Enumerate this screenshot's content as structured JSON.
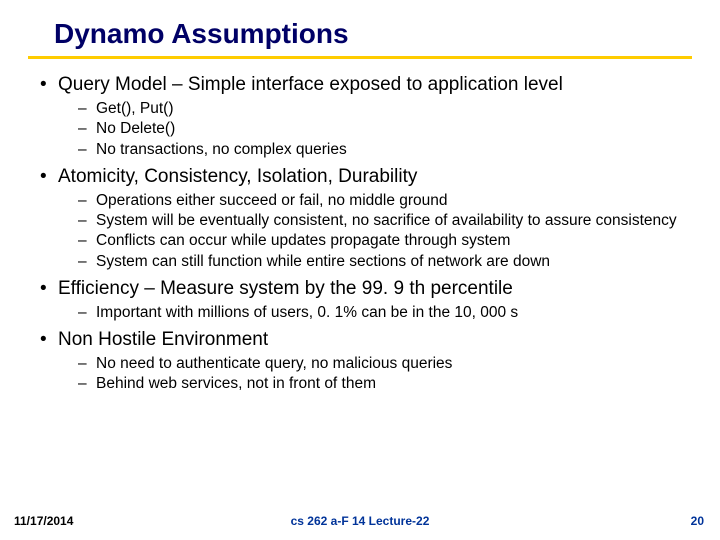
{
  "title": "Dynamo Assumptions",
  "bullets": [
    {
      "text": "Query Model – Simple interface exposed to application level",
      "sub": [
        "Get(), Put()",
        "No Delete()",
        "No transactions, no complex queries"
      ]
    },
    {
      "text": "Atomicity, Consistency, Isolation, Durability",
      "sub": [
        "Operations either succeed or fail, no middle ground",
        "System will be eventually consistent, no sacrifice of availability to assure consistency",
        "Conflicts can occur while updates propagate through system",
        "System can still function while entire sections of network are down"
      ]
    },
    {
      "text": "Efficiency – Measure system by the 99. 9 th percentile",
      "sub": [
        "Important with millions of users, 0. 1% can be in the 10, 000 s"
      ]
    },
    {
      "text": "Non Hostile Environment",
      "sub": [
        "No need to authenticate query, no malicious queries",
        "Behind web services, not in front of them"
      ]
    }
  ],
  "footer": {
    "date": "11/17/2014",
    "center": "cs 262 a-F 14 Lecture-22",
    "page": "20"
  }
}
